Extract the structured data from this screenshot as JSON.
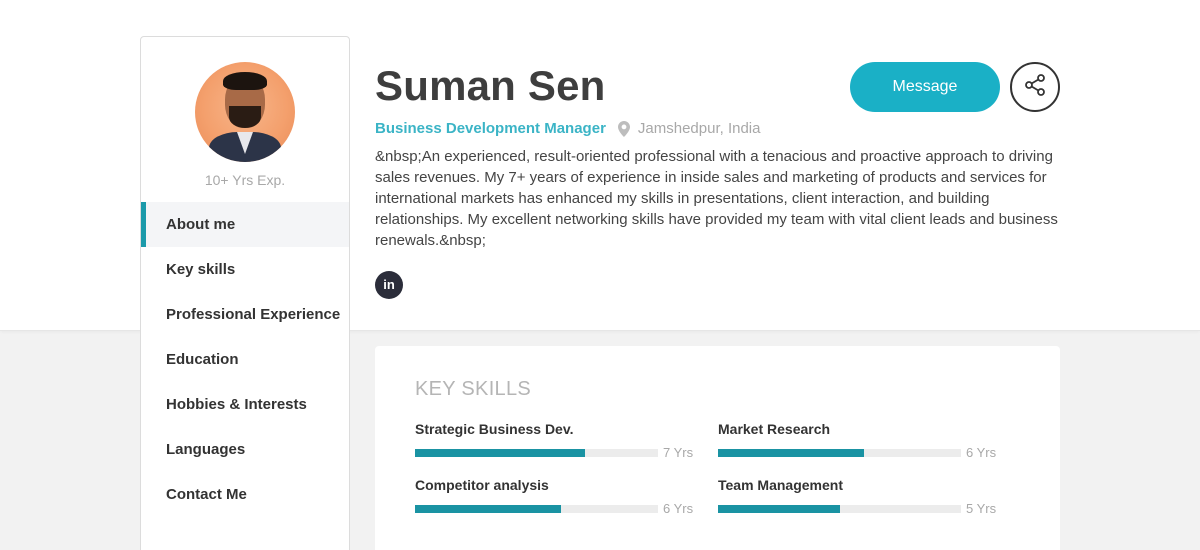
{
  "profile": {
    "name": "Suman Sen",
    "job_title": "Business Development Manager",
    "location": "Jamshedpur, India",
    "experience": "10+ Yrs Exp.",
    "bio": "&nbsp;An experienced, result-oriented professional with a tenacious and proactive approach to driving sales revenues. My 7+ years of experience in inside sales and marketing of products and services for international markets has enhanced my skills in presentations, client interaction, and building relationships. My excellent networking skills have provided my team with vital client leads and business renewals.&nbsp;",
    "linkedin_label": "in"
  },
  "actions": {
    "message_label": "Message"
  },
  "sidebar": {
    "items": [
      {
        "label": "About me",
        "active": true
      },
      {
        "label": "Key skills",
        "active": false
      },
      {
        "label": "Professional Experience",
        "active": false
      },
      {
        "label": "Education",
        "active": false
      },
      {
        "label": "Hobbies & Interests",
        "active": false
      },
      {
        "label": "Languages",
        "active": false
      },
      {
        "label": "Contact Me",
        "active": false
      }
    ]
  },
  "skills": {
    "heading": "KEY SKILLS",
    "items": [
      {
        "name": "Strategic Business Dev.",
        "years_label": "7 Yrs",
        "level": 0.7
      },
      {
        "name": "Market Research",
        "years_label": "6 Yrs",
        "level": 0.6
      },
      {
        "name": "Competitor analysis",
        "years_label": "6 Yrs",
        "level": 0.6
      },
      {
        "name": "Team Management",
        "years_label": "5 Yrs",
        "level": 0.5
      }
    ]
  },
  "icons": {
    "location": "map-pin-icon",
    "share": "share-icon",
    "linkedin": "linkedin-icon"
  },
  "colors": {
    "accent": "#1ab0c6",
    "job_title": "#3bb4c6",
    "bar_fill": "#1a93a3",
    "active_marker": "#1b9aaa"
  }
}
